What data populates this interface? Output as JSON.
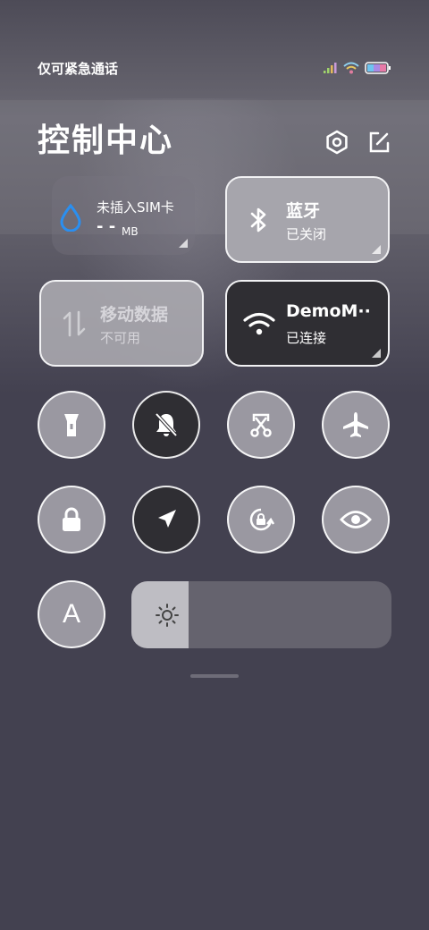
{
  "status_bar": {
    "carrier_text": "仅可紧急通话",
    "icons": [
      "signal-icon",
      "wifi-icon",
      "battery-icon"
    ]
  },
  "header": {
    "title": "控制中心",
    "settings_icon": "settings-icon",
    "edit_icon": "edit-icon"
  },
  "tiles": {
    "data_usage": {
      "title": "未插入SIM卡",
      "value": "- -",
      "unit": "MB",
      "icon": "water-drop-icon"
    },
    "bluetooth": {
      "title": "蓝牙",
      "status": "已关闭",
      "icon": "bluetooth-icon"
    },
    "mobile_data": {
      "title": "移动数据",
      "status": "不可用",
      "icon": "data-arrows-icon"
    },
    "wifi": {
      "title": "DemoM··",
      "status": "已连接",
      "icon": "wifi-icon"
    }
  },
  "toggles": [
    {
      "name": "flashlight",
      "icon": "flashlight-icon",
      "state": "off"
    },
    {
      "name": "silent",
      "icon": "bell-off-icon",
      "state": "on"
    },
    {
      "name": "screenshot",
      "icon": "scissors-icon",
      "state": "off"
    },
    {
      "name": "airplane-mode",
      "icon": "airplane-icon",
      "state": "off"
    },
    {
      "name": "lock-screen",
      "icon": "lock-icon",
      "state": "off"
    },
    {
      "name": "location",
      "icon": "location-arrow-icon",
      "state": "on"
    },
    {
      "name": "rotation-lock",
      "icon": "rotation-lock-icon",
      "state": "off"
    },
    {
      "name": "reading-mode",
      "icon": "eye-icon",
      "state": "off"
    },
    {
      "name": "auto-brightness",
      "icon": "letter-a-icon",
      "label": "A",
      "state": "off"
    }
  ],
  "brightness": {
    "level": 0.22,
    "icon": "sun-icon"
  },
  "colors": {
    "background": "#434150",
    "tile_light": "#a6a5ac",
    "tile_dark": "#2f2e33",
    "accent_blue": "#2a8ff0"
  }
}
